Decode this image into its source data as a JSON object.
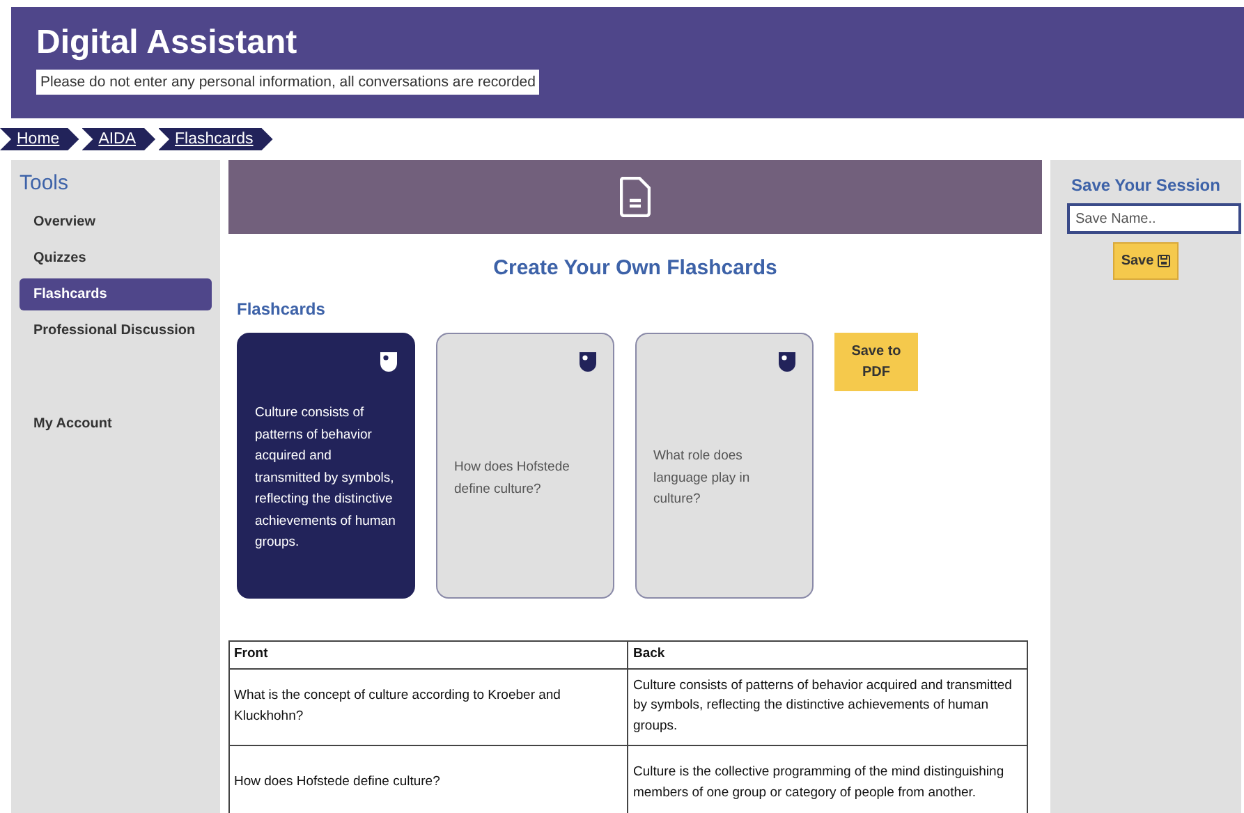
{
  "header": {
    "title": "Digital Assistant",
    "notice": "Please do not enter any personal information, all conversations are recorded"
  },
  "breadcrumbs": [
    "Home",
    "AIDA",
    "Flashcards"
  ],
  "sidebar": {
    "title": "Tools",
    "items": [
      {
        "label": "Overview",
        "selected": false
      },
      {
        "label": "Quizzes",
        "selected": false
      },
      {
        "label": "Flashcards",
        "selected": true
      },
      {
        "label": "Professional Discussion",
        "selected": false
      }
    ],
    "account": "My Account"
  },
  "main": {
    "heading": "Create Your Own Flashcards",
    "section": "Flashcards",
    "cards": [
      {
        "text": "Culture consists of patterns of behavior acquired and transmitted by symbols, reflecting the distinctive achievements of human groups.",
        "flipped": true
      },
      {
        "text": "How does Hofstede define culture?",
        "flipped": false
      },
      {
        "text": "What role does language play in culture?",
        "flipped": false
      }
    ],
    "pdf_button": "Save to PDF",
    "table": {
      "columns": [
        "Front",
        "Back"
      ],
      "rows": [
        [
          "What is the concept of culture according to Kroeber and Kluckhohn?",
          "Culture consists of patterns of behavior acquired and transmitted by symbols, reflecting the distinctive achievements of human groups."
        ],
        [
          "How does Hofstede define culture?",
          "Culture is the collective programming of the mind distinguishing members of one group or category of people from another."
        ]
      ]
    }
  },
  "session": {
    "title": "Save Your Session",
    "placeholder": "Save Name..",
    "button": "Save"
  }
}
